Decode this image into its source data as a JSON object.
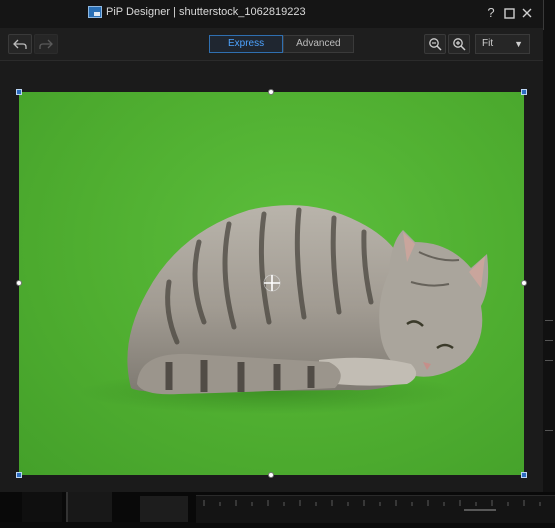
{
  "window": {
    "app_name": "PiP Designer",
    "separator": "|",
    "file_name": "shutterstock_1062819223"
  },
  "window_controls": {
    "help_icon": "question-mark",
    "maximize_icon": "square",
    "close_icon": "x"
  },
  "toolbar": {
    "undo_icon": "undo-arrow",
    "redo_icon": "redo-arrow",
    "tabs": [
      {
        "label": "Express",
        "active": true
      },
      {
        "label": "Advanced",
        "active": false
      }
    ],
    "zoom_out_icon": "magnifier-minus",
    "zoom_in_icon": "magnifier-plus",
    "zoom_value": "Fit"
  },
  "colors": {
    "accent": "#4da3ff",
    "chroma_green": "#52b334",
    "window_bg": "#1e1e1e",
    "selection_corner": "#2d6cc0"
  },
  "canvas": {
    "content": "photo of a tabby cat lying on a green screen background",
    "move_cursor_icon": "four-way-crosshair"
  }
}
